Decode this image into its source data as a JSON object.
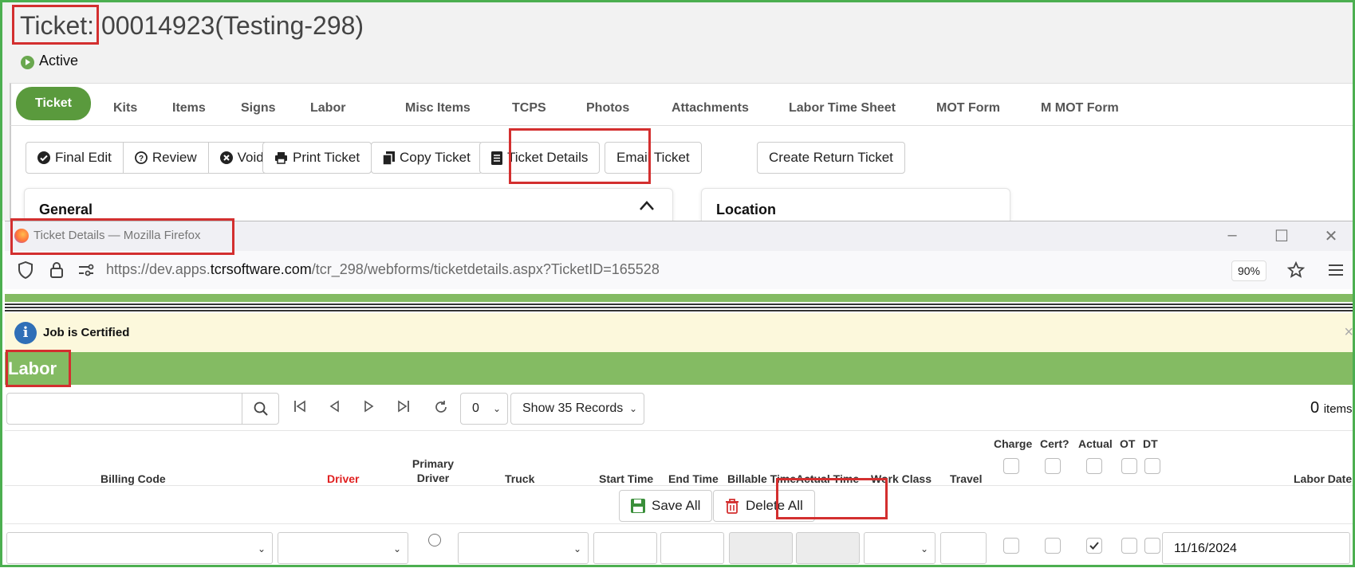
{
  "ticket": {
    "title_prefix": "Ticket:",
    "title_number": "00014923(Testing-298)",
    "status": "Active"
  },
  "tabs": [
    "Ticket",
    "Kits",
    "Items",
    "Signs",
    "Labor",
    "Misc Items",
    "TCPS",
    "Photos",
    "Attachments",
    "Labor Time Sheet",
    "MOT Form",
    "M MOT Form"
  ],
  "actions": {
    "final_edit": "Final Edit",
    "review": "Review",
    "void": "Void",
    "print_ticket": "Print Ticket",
    "copy_ticket": "Copy Ticket",
    "ticket_details": "Ticket Details",
    "email_ticket": "Email Ticket",
    "create_return_ticket": "Create Return Ticket"
  },
  "cards": {
    "general": "General",
    "location": "Location"
  },
  "firefox": {
    "window_title": "Ticket Details — Mozilla Firefox",
    "url_prefix": "https://dev.apps.",
    "url_domain": "tcrsoftware.com",
    "url_path": "/tcr_298/webforms/ticketdetails.aspx?TicketID=165528",
    "zoom": "90%"
  },
  "alert": {
    "text": "Job is Certified",
    "close": "×"
  },
  "labor": {
    "title": "Labor",
    "page_select": "0",
    "show_records": "Show 35 Records",
    "items_count": "0",
    "items_label": "items"
  },
  "columns": {
    "billing_code": "Billing Code",
    "driver": "Driver",
    "primary": "Primary",
    "primary_driver": "Driver",
    "truck": "Truck",
    "start_time": "Start Time",
    "end_time": "End Time",
    "billable_time": "Billable Time",
    "actual_time": "Actual Time",
    "work_class": "Work Class",
    "travel": "Travel",
    "charge": "Charge",
    "cert": "Cert?",
    "actual": "Actual",
    "ot": "OT",
    "dt": "DT",
    "labor_date": "Labor Date"
  },
  "row_actions": {
    "save_all": "Save All",
    "delete_all": "Delete All"
  },
  "row": {
    "labor_date": "11/16/2024",
    "actual_checked": true
  },
  "colors": {
    "green_accent": "#84bb63",
    "active_tab": "#5a9a3d",
    "highlight": "#d32f2f",
    "driver_label": "#e02020"
  }
}
